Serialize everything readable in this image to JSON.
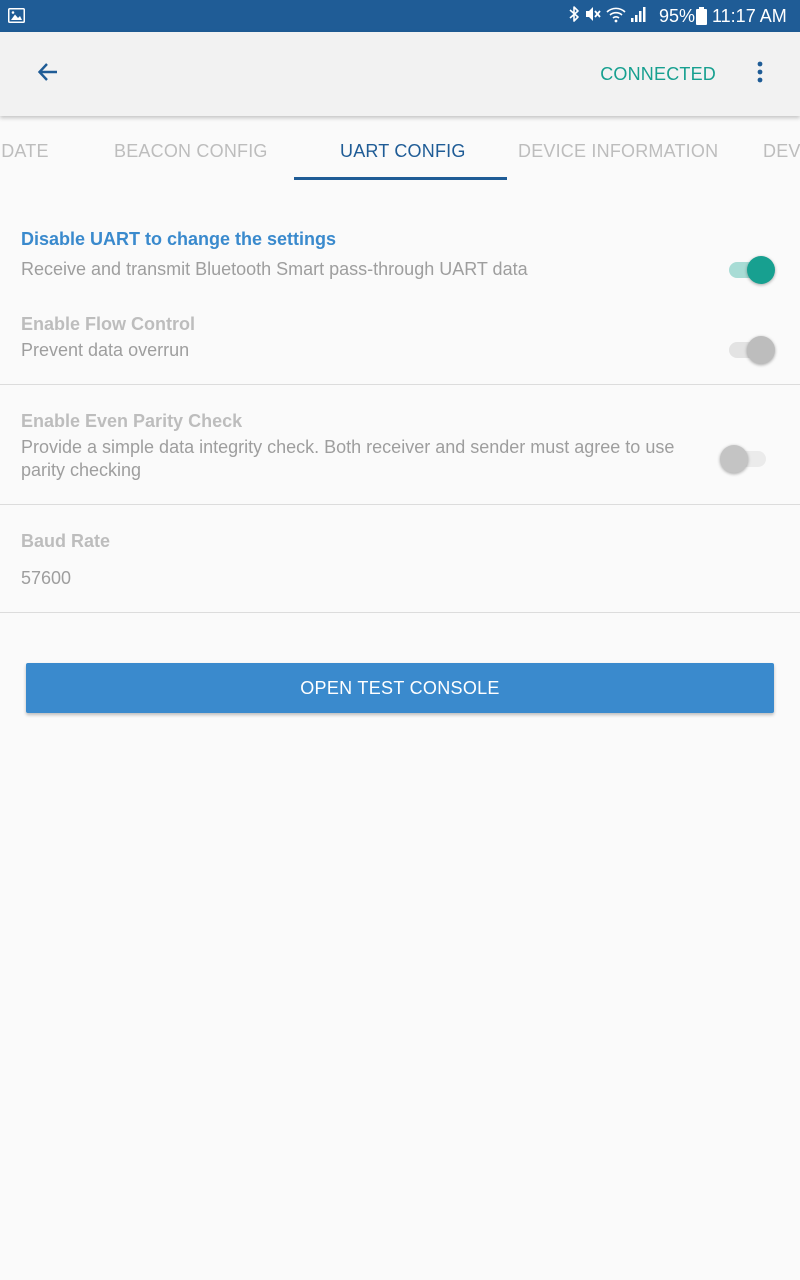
{
  "status_bar": {
    "battery": "95%",
    "time": "11:17 AM",
    "icons": [
      "image-icon",
      "bluetooth-icon",
      "mute-icon",
      "wifi-icon",
      "signal-icon",
      "battery-icon"
    ]
  },
  "app_bar": {
    "back_icon": "arrow-left-icon",
    "status": "CONNECTED",
    "menu_icon": "more-vert-icon"
  },
  "tabs": [
    {
      "label": "PDATE",
      "active": false
    },
    {
      "label": "BEACON CONFIG",
      "active": false
    },
    {
      "label": "UART CONFIG",
      "active": true
    },
    {
      "label": "DEVICE INFORMATION",
      "active": false
    },
    {
      "label": "DEVI",
      "active": false
    }
  ],
  "settings": {
    "uart": {
      "title": "Disable UART to change the settings",
      "description": "Receive and transmit Bluetooth Smart pass-through UART data",
      "enabled": true
    },
    "flow_control": {
      "title": "Enable Flow Control",
      "description": "Prevent data overrun",
      "enabled": true,
      "disabled": true
    },
    "parity": {
      "title": "Enable Even Parity Check",
      "description": "Provide a simple data integrity check. Both receiver and sender must agree to use parity checking",
      "enabled": false,
      "disabled": true
    },
    "baud_rate": {
      "title": "Baud Rate",
      "value": "57600"
    }
  },
  "actions": {
    "open_test_console": "OPEN TEST CONSOLE"
  },
  "colors": {
    "status_bar": "#1f5c96",
    "accent": "#17a090",
    "primary": "#1f5c96",
    "uart_title": "#3a8acd",
    "button": "#3a8acd"
  }
}
